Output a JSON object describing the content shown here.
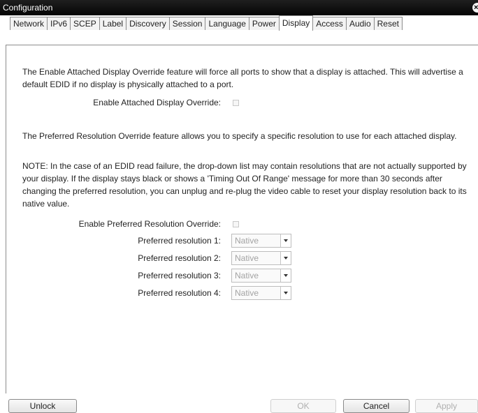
{
  "window": {
    "title": "Configuration",
    "close_glyph": "×"
  },
  "tabs": [
    {
      "label": "Network"
    },
    {
      "label": "IPv6"
    },
    {
      "label": "SCEP"
    },
    {
      "label": "Label"
    },
    {
      "label": "Discovery"
    },
    {
      "label": "Session"
    },
    {
      "label": "Language"
    },
    {
      "label": "Power"
    },
    {
      "label": "Display",
      "active": true
    },
    {
      "label": "Access"
    },
    {
      "label": "Audio"
    },
    {
      "label": "Reset"
    }
  ],
  "display": {
    "attached_desc": "The Enable Attached Display Override feature will force all ports to show that a display is attached. This will advertise a default EDID if no display is physically attached to a port.",
    "attached_label": "Enable Attached Display Override:",
    "attached_checked": false,
    "preferred_desc": "The Preferred Resolution Override feature allows you to specify a specific resolution to use for each attached display.",
    "note": "NOTE: In the case of an EDID read failure, the drop-down list may contain resolutions that are not actually supported by your display. If the display stays black or shows a 'Timing Out Of Range' message for more than 30 seconds after changing the preferred resolution, you can unplug and re-plug the video cable to reset your display resolution back to its native value.",
    "preferred_label": "Enable Preferred Resolution Override:",
    "preferred_checked": false,
    "resolutions": [
      {
        "label": "Preferred resolution 1:",
        "value": "Native"
      },
      {
        "label": "Preferred resolution 2:",
        "value": "Native"
      },
      {
        "label": "Preferred resolution 3:",
        "value": "Native"
      },
      {
        "label": "Preferred resolution 4:",
        "value": "Native"
      }
    ]
  },
  "buttons": {
    "unlock": "Unlock",
    "ok": "OK",
    "cancel": "Cancel",
    "apply": "Apply"
  }
}
